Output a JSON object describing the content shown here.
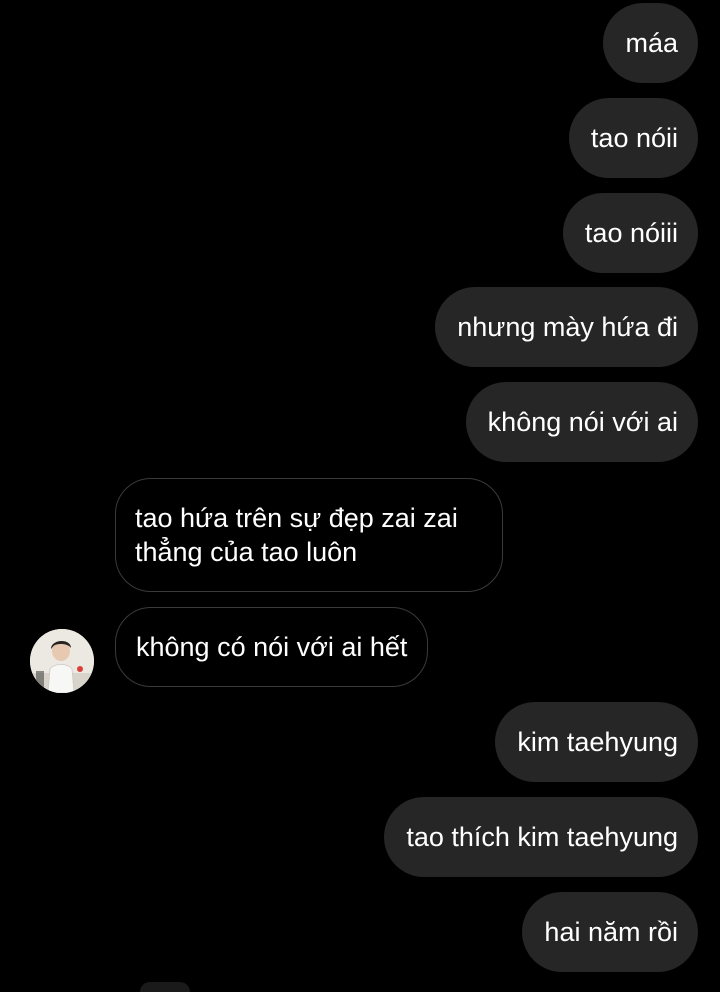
{
  "conversation": {
    "messages": [
      {
        "id": "m1",
        "sender": "me",
        "text": "máa"
      },
      {
        "id": "m2",
        "sender": "me",
        "text": "tao nóii"
      },
      {
        "id": "m3",
        "sender": "me",
        "text": "tao nóiii"
      },
      {
        "id": "m4",
        "sender": "me",
        "text": "nhưng mày hứa đi"
      },
      {
        "id": "m5",
        "sender": "me",
        "text": "không nói với ai"
      },
      {
        "id": "m6",
        "sender": "other",
        "text": "tao hứa trên sự đẹp zai zai thẳng của tao luôn"
      },
      {
        "id": "m7",
        "sender": "other",
        "text": "không có nói với ai hết"
      },
      {
        "id": "m8",
        "sender": "me",
        "text": "kim taehyung"
      },
      {
        "id": "m9",
        "sender": "me",
        "text": "tao thích kim taehyung"
      },
      {
        "id": "m10",
        "sender": "me",
        "text": "hai năm rồi"
      }
    ]
  },
  "theme": {
    "background": "#000000",
    "sent_bubble": "#262626",
    "received_border": "#3a3a3a",
    "text": "#ffffff"
  },
  "icons": {
    "contact_avatar": "avatar-photo"
  }
}
